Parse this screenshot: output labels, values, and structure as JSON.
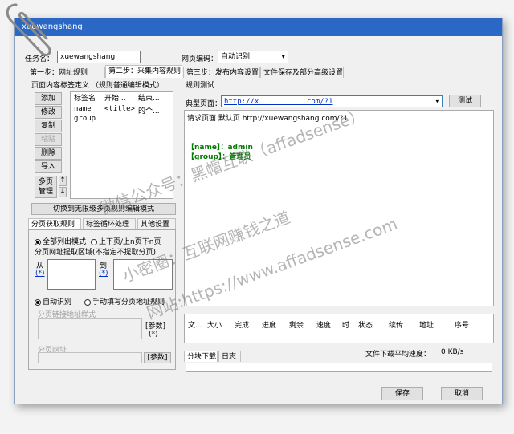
{
  "window": {
    "title": "xuewangshang"
  },
  "task": {
    "name_label": "任务名：",
    "name_value": "xuewangshang",
    "encoding_label": "网页编码：",
    "encoding_value": "自动识别"
  },
  "tabs": [
    "第一步：网址规则",
    "第二步：采集内容规则",
    "第三步：发布内容设置",
    "文件保存及部分高级设置"
  ],
  "left": {
    "section_title": "页面内容标签定义 （规则普通编辑模式）",
    "buttons": [
      "添加",
      "修改",
      "复制",
      "粘贴",
      "删除",
      "导入"
    ],
    "multipage_btn": "多页\n管理",
    "arrow_up": "↑",
    "arrow_down": "↓",
    "table_headers": [
      "标签名",
      "开始...",
      "结束..."
    ],
    "rows": [
      {
        "name": "name",
        "start": "<title>",
        "end": "的个..."
      },
      {
        "name": "group",
        "start": "",
        "end": ""
      }
    ],
    "switch_btn": "切换到无限级多页规则编辑模式",
    "subtabs": [
      "分页获取规则",
      "标签循环处理",
      "其他设置"
    ],
    "mode_all": "全部列出模式",
    "mode_prev_next": "上下页/上n页下n页",
    "range_label": "分页网址提取区域(不指定不提取分页)",
    "from_label": "从",
    "to_label": "到",
    "star_link": "(*)",
    "auto_detect": "自动识别",
    "manual_rule": "手动填写分页地址规则",
    "link_style_label": "分页链接地址样式",
    "param_label": "[参数]",
    "star_label": "(*)",
    "page_url_label": "分页网址",
    "param_btn": "[参数]"
  },
  "right": {
    "section_title": "规则测试",
    "typical_label": "典型页面：",
    "typical_value": "http://x___________com/?1",
    "test_btn": "测试",
    "output_lines": [
      "请求页面 默认页 http://xuewangshang.com/?1",
      "",
      "",
      "【name】：admin",
      "【group】：管理员"
    ],
    "download_headers": [
      "文...",
      "大小",
      "完成",
      "进度",
      "剩余",
      "速度",
      "时",
      "状态",
      "续传",
      "地址",
      "序号"
    ],
    "bottom_tabs": [
      "分块下载",
      "日志"
    ],
    "avg_speed_label": "文件下载平均速度：",
    "avg_speed_value": "0 KB/s"
  },
  "footer": {
    "save_btn": "保存",
    "cancel_btn": "取消"
  },
  "watermark": {
    "line1": "微信公众号：黑帽互联（affadsense）",
    "line2": "小密圈：互联网赚钱之道",
    "line3": "网站:https://www.affadsense.com"
  },
  "colors": {
    "titlebar": "#2b67c5",
    "tag_green": "#008000",
    "link_blue": "#0033cc"
  }
}
